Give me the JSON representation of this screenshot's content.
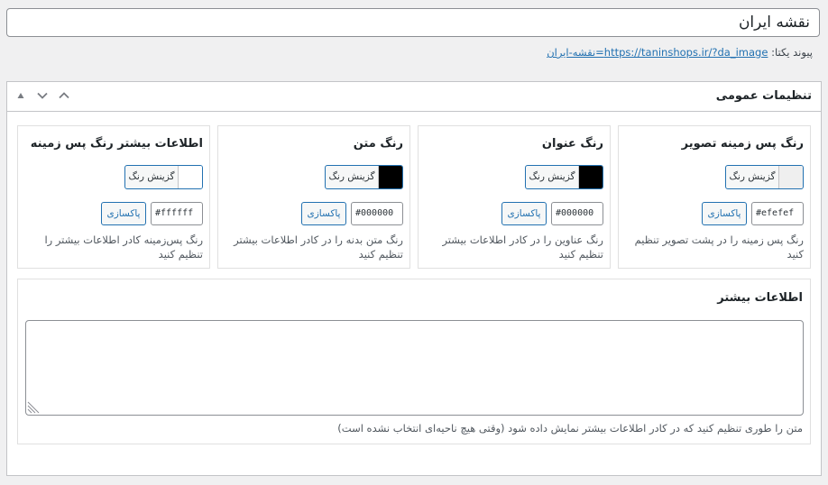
{
  "title": {
    "value": "نقشه ایران"
  },
  "permalink": {
    "label": "پیوند یکتا:",
    "url": "https://taninshops.ir/?da_image=نقشه-ایران"
  },
  "postbox": {
    "title": "تنظیمات عمومی",
    "actions": {
      "up": "▲",
      "chevron_up": "⌃",
      "chevron_down": "⌄"
    }
  },
  "color_fields": [
    {
      "title": "رنگ پس زمینه تصویر",
      "button_label": "گزینش رنگ",
      "swatch": "#efefef",
      "hex": "#efefef",
      "clear_label": "پاکسازی",
      "description": "رنگ پس زمینه را در پشت تصویر تنظیم کنید"
    },
    {
      "title": "رنگ عنوان",
      "button_label": "گزینش رنگ",
      "swatch": "#000000",
      "hex": "#000000",
      "clear_label": "پاکسازی",
      "description": "رنگ عناوین را در کادر اطلاعات بیشتر تنظیم کنید"
    },
    {
      "title": "رنگ متن",
      "button_label": "گزینش رنگ",
      "swatch": "#000000",
      "hex": "#000000",
      "clear_label": "پاکسازی",
      "description": "رنگ متن بدنه را در کادر اطلاعات بیشتر تنظیم کنید"
    },
    {
      "title": "اطلاعات بیشتر رنگ پس زمینه",
      "button_label": "گزینش رنگ",
      "swatch": "#ffffff",
      "hex": "#ffffff",
      "clear_label": "پاکسازی",
      "description": "رنگ پس‌زمینه کادر اطلاعات بیشتر را تنظیم کنید"
    }
  ],
  "more_info": {
    "title": "اطلاعات بیشتر",
    "value": "",
    "description": "متن را طوری تنظیم کنید که در کادر اطلاعات بیشتر نمایش داده شود (وقتی هیچ ناحیه‌ای انتخاب نشده است)"
  }
}
